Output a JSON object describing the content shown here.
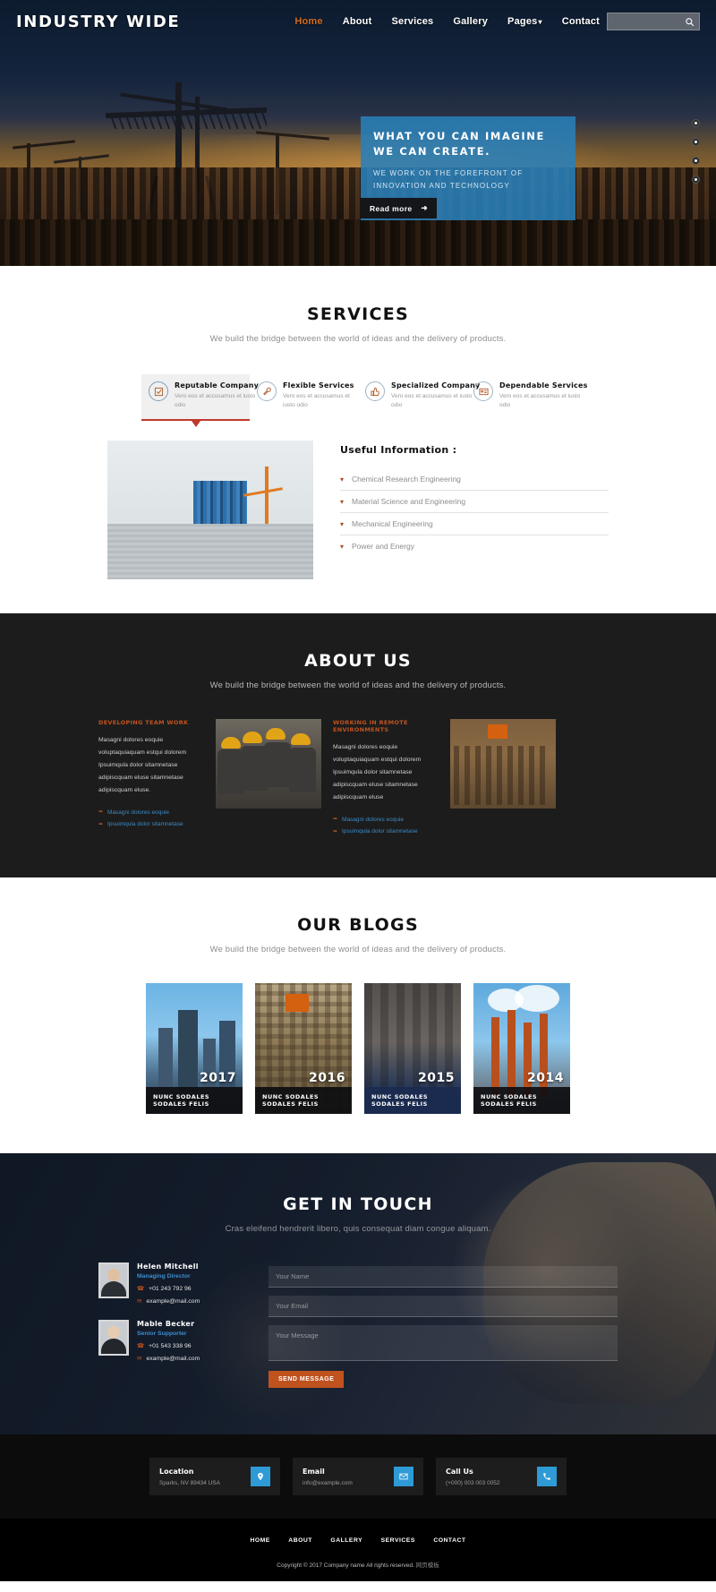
{
  "nav": {
    "brand": "INDUSTRY WIDE",
    "links": [
      {
        "label": "Home",
        "active": true
      },
      {
        "label": "About",
        "active": false
      },
      {
        "label": "Services",
        "active": false
      },
      {
        "label": "Gallery",
        "active": false
      },
      {
        "label": "Pages",
        "active": false,
        "caret": "▾"
      },
      {
        "label": "Contact",
        "active": false
      }
    ],
    "search_placeholder": "",
    "search_value": "",
    "search_icon": "search-icon"
  },
  "hero": {
    "headline": "WHAT YOU CAN IMAGINE WE CAN CREATE.",
    "subline": "WE WORK ON THE FOREFRONT OF INNOVATION AND TECHNOLOGY",
    "cta": "Read more",
    "cta_icon": "➜",
    "dots": 4,
    "accent": "#2980b9"
  },
  "services": {
    "title": "SERVICES",
    "subtitle": "We build the bridge between the world of ideas and the delivery of products.",
    "tabs": [
      {
        "title": "Reputable Company",
        "desc": "Vero eos et accusamus et iusto odio",
        "icon": "check-square-icon",
        "active": true
      },
      {
        "title": "Flexible Services",
        "desc": "Vero eos et accusamus et iusto odio",
        "icon": "wrench-icon",
        "active": false
      },
      {
        "title": "Specialized Company",
        "desc": "Vero eos et accusamus et iusto odio",
        "icon": "thumbs-up-icon",
        "active": false
      },
      {
        "title": "Dependable Services",
        "desc": "Vero eos et accusamus et iusto odio",
        "icon": "id-card-icon",
        "active": false
      }
    ],
    "panel_heading": "Useful Information :",
    "accordion": [
      {
        "label": "Chemical Research Engineering"
      },
      {
        "label": "Material Science and Engineering"
      },
      {
        "label": "Mechanical Engineering"
      },
      {
        "label": "Power and Energy"
      }
    ]
  },
  "about": {
    "title": "ABOUT US",
    "subtitle": "We build the bridge between the world of ideas and the delivery of products.",
    "columns": [
      {
        "heading": "DEVELOPING TEAM WORK",
        "body": "Masagni dolores eoquie voluptaquiaquam estqui dolorem Ipsuimqula dolor sitamnetase adipiscquam eluse sitamnetase adipiscquam eluse.",
        "bullets": [
          "Masagni dolores eoquie",
          "Ipsuimqula dolor sitamnetase"
        ]
      },
      {
        "heading": "WORKING IN REMOTE ENVIRONMENTS",
        "body": "Masagni dolores eoquie voluptaquiaquam estqui dolorem Ipsuimqula dolor sitamnetase adipiscquam eluse sitamnetase adipiscquam eluse",
        "bullets": [
          "Masagni dolores eoquie",
          "Ipsuimqula dolor sitamnetase"
        ]
      }
    ]
  },
  "blogs": {
    "title": "OUR BLOGS",
    "subtitle": "We build the bridge between the world of ideas and the delivery of products.",
    "cards": [
      {
        "year": "2017",
        "label": "NUNC SODALES SODALES FELIS"
      },
      {
        "year": "2016",
        "label": "NUNC SODALES SODALES FELIS"
      },
      {
        "year": "2015",
        "label": "NUNC SODALES SODALES FELIS"
      },
      {
        "year": "2014",
        "label": "NUNC SODALES SODALES FELIS"
      }
    ]
  },
  "contact": {
    "title": "GET IN TOUCH",
    "subtitle": "Cras eleifend hendrerit libero, quis consequat diam congue aliquam.",
    "people": [
      {
        "name": "Helen Mitchell",
        "role": "Managing Director",
        "phone": "+01 243 792 96",
        "email": "example@mail.com",
        "phone_icon": "phone-icon",
        "email_icon": "envelope-icon"
      },
      {
        "name": "Mable Becker",
        "role": "Senior Supporter",
        "phone": "+01 543 338 96",
        "email": "example@mail.com",
        "phone_icon": "phone-icon",
        "email_icon": "envelope-icon"
      }
    ],
    "form": {
      "name_placeholder": "Your Name",
      "email_placeholder": "Your Email",
      "message_placeholder": "Your Message",
      "submit": "SEND MESSAGE",
      "submit_color": "#c0521e"
    }
  },
  "footer": {
    "cards": [
      {
        "title": "Location",
        "value": "Sparks, NV 89434 USA",
        "icon": "map-pin-icon"
      },
      {
        "title": "Email",
        "value": "info@example.com",
        "icon": "envelope-icon"
      },
      {
        "title": "Call Us",
        "value": "(+000) 003 003 0052",
        "icon": "phone-icon"
      }
    ],
    "links": [
      "HOME",
      "ABOUT",
      "GALLERY",
      "SERVICES",
      "CONTACT"
    ],
    "copyright": "Copyright © 2017 Company name All rights reserved.",
    "credit": "网页模板"
  }
}
